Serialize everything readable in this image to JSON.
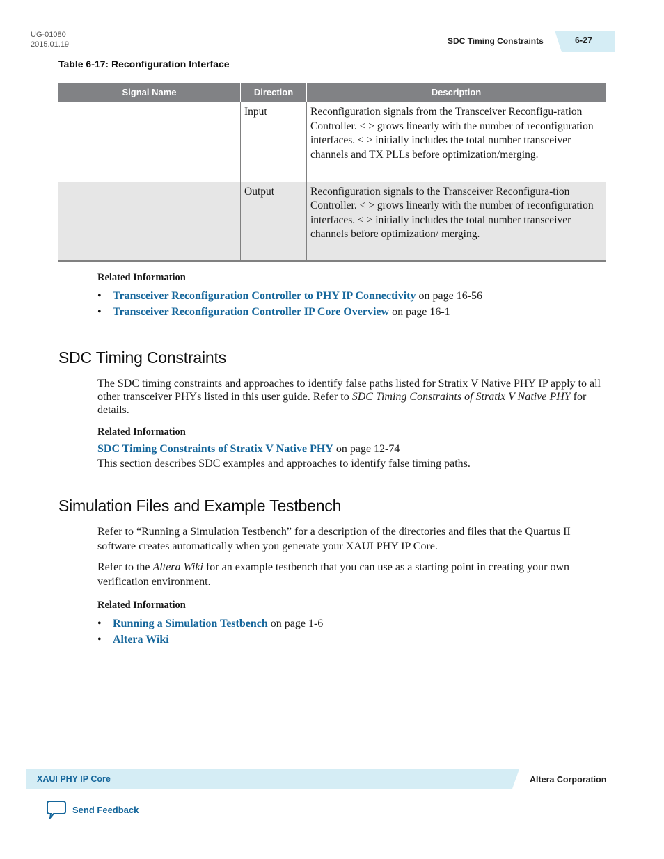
{
  "header": {
    "doc_id": "UG-01080",
    "doc_date": "2015.01.19",
    "section_title": "SDC Timing Constraints",
    "page_number": "6-27"
  },
  "table": {
    "caption": "Table 6-17: Reconfiguration Interface",
    "columns": [
      "Signal Name",
      "Direction",
      "Description"
    ],
    "rows": [
      {
        "signal_name": "",
        "direction": "Input",
        "description": "Reconfiguration signals from the Transceiver Reconfigu-ration Controller. < > grows linearly with the number of reconfiguration interfaces. < > initially includes the total number transceiver channels and TX PLLs before optimization/merging."
      },
      {
        "signal_name": "",
        "direction": "Output",
        "description": "Reconfiguration signals to the Transceiver Reconfigura-tion Controller. < > grows linearly with the number of reconfiguration interfaces. < > initially includes the total number transceiver channels before optimization/ merging."
      }
    ]
  },
  "related1": {
    "heading": "Related Information",
    "items": [
      {
        "link": "Transceiver Reconfiguration Controller to PHY IP Connectivity",
        "suffix": " on page 16-56"
      },
      {
        "link": "Transceiver Reconfiguration Controller IP Core Overview",
        "suffix": " on page 16-1"
      }
    ]
  },
  "sdc": {
    "title": "SDC Timing Constraints",
    "para_start": "The SDC timing constraints and approaches to identify false paths listed for Stratix V Native PHY IP apply to all other transceiver PHYs listed in this user guide. Refer to ",
    "para_italic": "SDC Timing Constraints of Stratix V Native PHY",
    "para_end": " for details.",
    "related_heading": "Related Information",
    "related_link": "SDC Timing Constraints of Stratix V Native PHY",
    "related_suffix": " on page 12-74",
    "related_desc": "This section describes SDC examples and approaches to identify false timing paths."
  },
  "sim": {
    "title": "Simulation Files and Example Testbench",
    "para1": "Refer to “Running a Simulation Testbench” for a description of the directories and files that the Quartus II software creates automatically when you generate your XAUI PHY IP Core.",
    "para2_start": "Refer to the ",
    "para2_italic": "Altera Wiki",
    "para2_end": " for an example testbench that you can use as a starting point in creating your own verification environment.",
    "related_heading": "Related Information",
    "items": [
      {
        "link": "Running a Simulation Testbench",
        "suffix": " on page 1-6"
      },
      {
        "link": "Altera Wiki",
        "suffix": ""
      }
    ]
  },
  "footer": {
    "product": "XAUI PHY IP Core",
    "company": "Altera Corporation",
    "feedback": "Send Feedback",
    "feedback_icon": "speech-bubble-icon"
  }
}
